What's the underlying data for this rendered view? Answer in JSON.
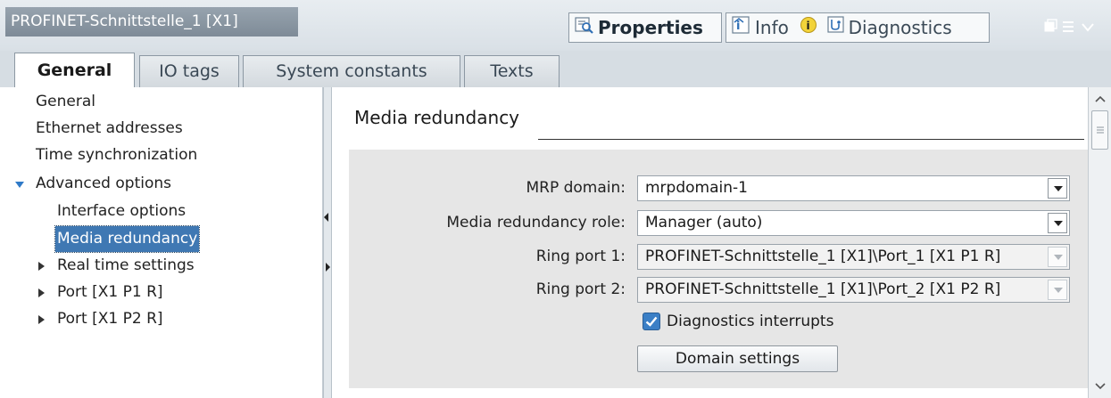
{
  "window": {
    "title": "PROFINET-Schnittstelle_1 [X1]"
  },
  "inspector_tabs": [
    {
      "label": "Properties",
      "icon": "properties-icon",
      "active": true
    },
    {
      "label": "Info",
      "icon": "info-icon",
      "badge_icon": "info-badge-icon",
      "active": false
    },
    {
      "label": "Diagnostics",
      "icon": "diagnostics-icon",
      "active": false
    }
  ],
  "tabs": [
    {
      "label": "General",
      "active": true
    },
    {
      "label": "IO tags",
      "active": false
    },
    {
      "label": "System constants",
      "active": false
    },
    {
      "label": "Texts",
      "active": false
    }
  ],
  "nav": {
    "items": [
      {
        "label": "General"
      },
      {
        "label": "Ethernet addresses"
      },
      {
        "label": "Time synchronization"
      },
      {
        "label": "Advanced options",
        "expanded": true
      },
      {
        "label": "Interface options"
      },
      {
        "label": "Media redundancy",
        "selected": true
      },
      {
        "label": "Real time settings",
        "expanded": false
      },
      {
        "label": "Port [X1 P1 R]",
        "expanded": false
      },
      {
        "label": "Port [X1 P2 R]",
        "expanded": false
      }
    ]
  },
  "section": {
    "title": "Media redundancy"
  },
  "form": {
    "mrp_domain": {
      "label": "MRP domain:",
      "value": "mrpdomain-1"
    },
    "role": {
      "label": "Media redundancy role:",
      "value": "Manager (auto)"
    },
    "ring_port_1": {
      "label": "Ring port 1:",
      "value": "PROFINET-Schnittstelle_1 [X1]\\Port_1 [X1 P1 R]"
    },
    "ring_port_2": {
      "label": "Ring port 2:",
      "value": "PROFINET-Schnittstelle_1 [X1]\\Port_2 [X1 P2 R]"
    },
    "diagnostics_interrupts": {
      "label": "Diagnostics interrupts",
      "checked": true
    },
    "domain_settings_button": "Domain settings"
  },
  "colors": {
    "accent": "#3f78b3",
    "panel": "#e6e6e6",
    "checkbox": "#3b7fc6"
  }
}
